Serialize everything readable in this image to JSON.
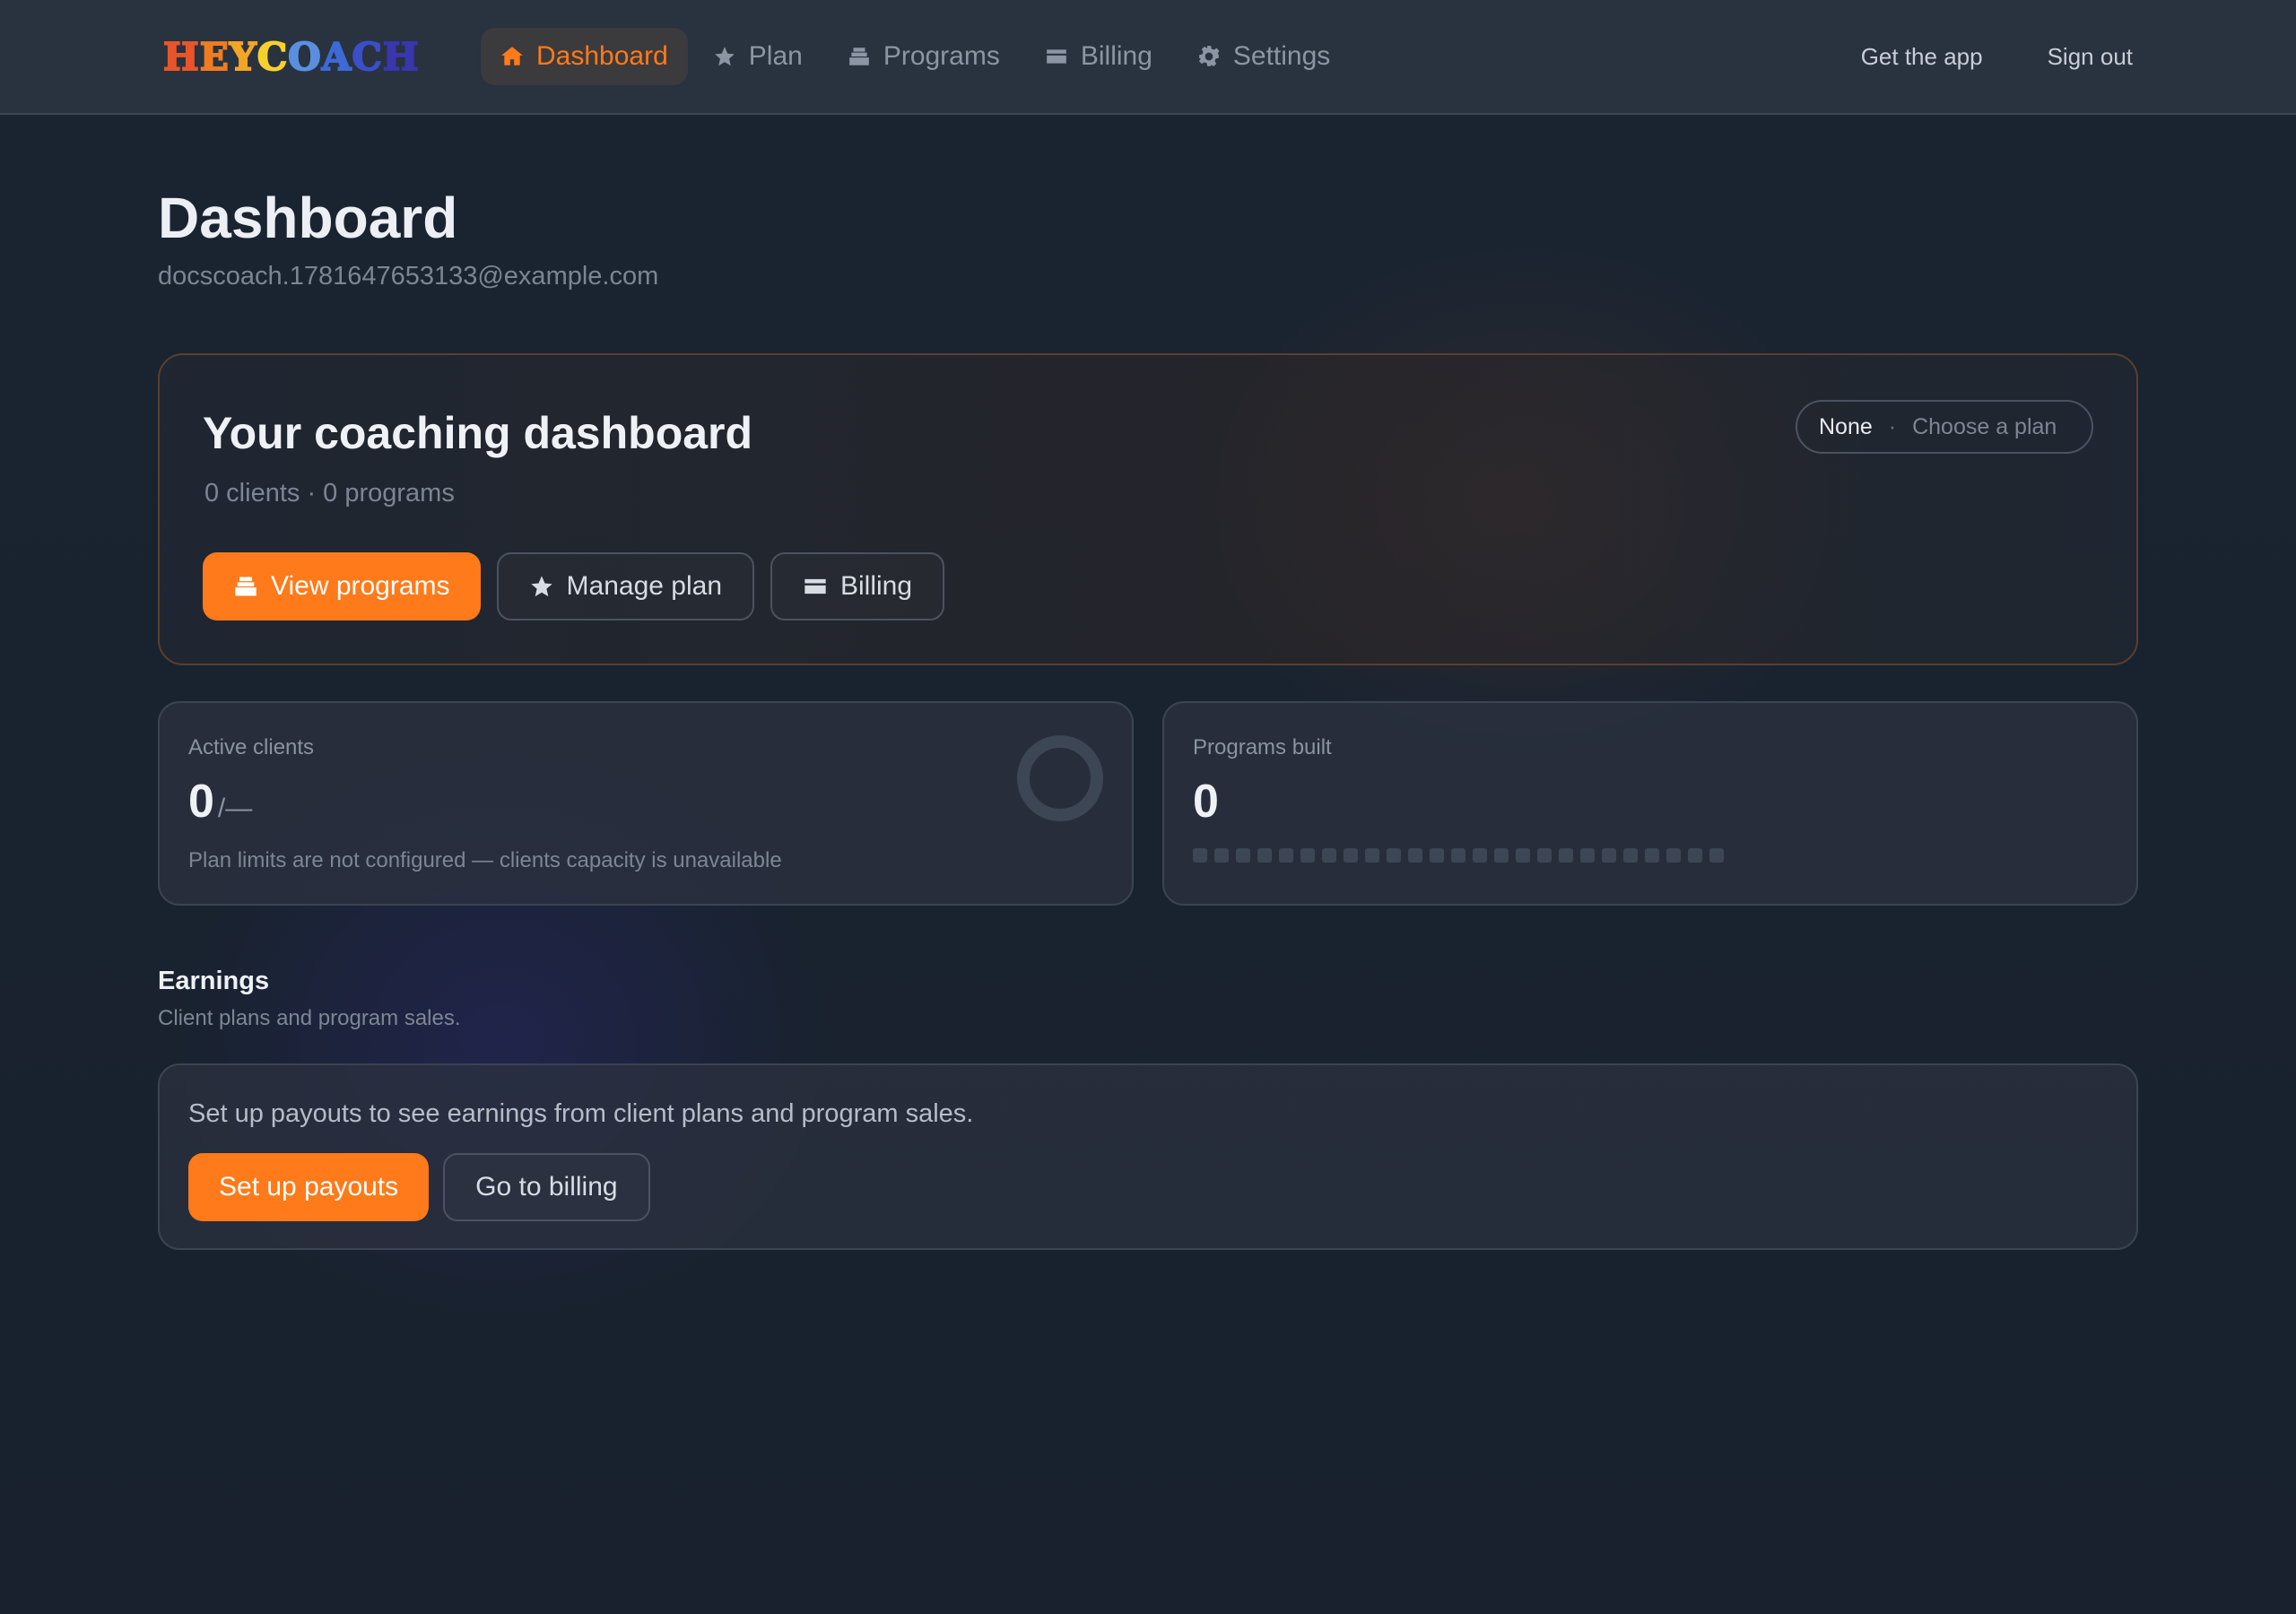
{
  "brand": {
    "letters": [
      {
        "ch": "H",
        "color": "#e8552a"
      },
      {
        "ch": "E",
        "color": "#f07c22"
      },
      {
        "ch": "Y",
        "color": "#f3a526"
      },
      {
        "ch": "C",
        "color": "#f6d12e"
      },
      {
        "ch": "O",
        "color": "#5a8fe0"
      },
      {
        "ch": "A",
        "color": "#3d6ad6"
      },
      {
        "ch": "C",
        "color": "#3b4fc8"
      },
      {
        "ch": "H",
        "color": "#3a36b0"
      }
    ]
  },
  "nav": {
    "items": [
      {
        "label": "Dashboard",
        "icon": "home-icon",
        "active": true
      },
      {
        "label": "Plan",
        "icon": "star-icon",
        "active": false
      },
      {
        "label": "Programs",
        "icon": "stack-icon",
        "active": false
      },
      {
        "label": "Billing",
        "icon": "card-icon",
        "active": false
      },
      {
        "label": "Settings",
        "icon": "gear-icon",
        "active": false
      }
    ],
    "get_app": "Get the app",
    "sign_out": "Sign out"
  },
  "header": {
    "title": "Dashboard",
    "email": "docscoach.1781647653133@example.com"
  },
  "hero": {
    "title": "Your coaching dashboard",
    "meta": "0 clients · 0 programs",
    "plan_value": "None",
    "plan_sep": "·",
    "plan_link": "Choose a plan",
    "buttons": {
      "view_programs": "View programs",
      "manage_plan": "Manage plan",
      "billing": "Billing"
    }
  },
  "stats": {
    "active_clients": {
      "label": "Active clients",
      "value": "0",
      "limit": "/—",
      "note": "Plan limits are not configured — clients capacity is unavailable"
    },
    "programs_built": {
      "label": "Programs built",
      "value": "0",
      "slots": 25
    }
  },
  "earnings": {
    "title": "Earnings",
    "subtitle": "Client plans and program sales.",
    "message": "Set up payouts to see earnings from client plans and program sales.",
    "setup_button": "Set up payouts",
    "billing_button": "Go to billing"
  },
  "colors": {
    "accent": "#ff7a1a",
    "background": "#1a2431",
    "card": "#2c3240"
  }
}
